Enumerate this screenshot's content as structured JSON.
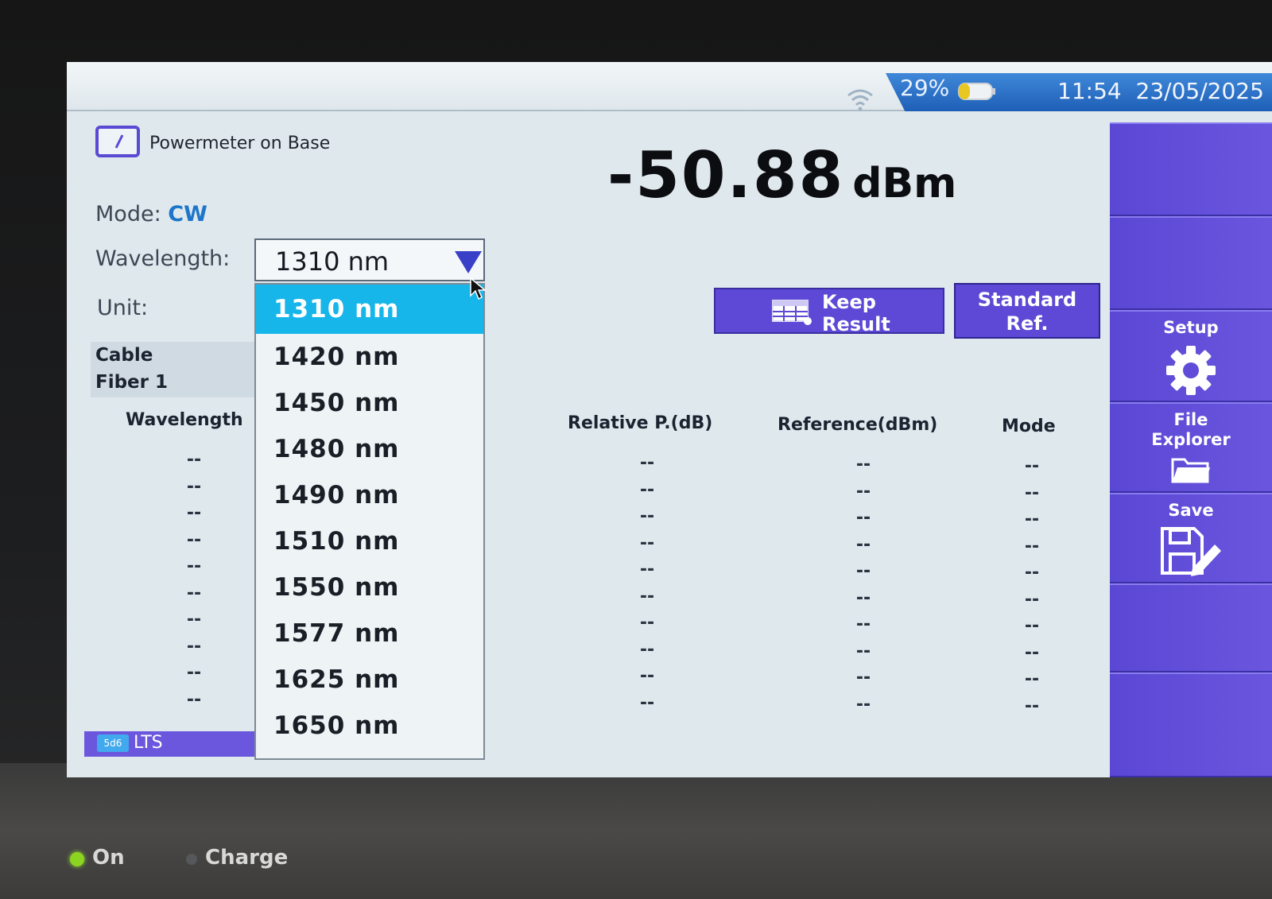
{
  "status_bar": {
    "battery_percent": "29%",
    "time": "11:54",
    "date": "23/05/2025"
  },
  "header": {
    "app_title": "Powermeter on Base",
    "reading_value": "-50.88",
    "reading_unit": "dBm"
  },
  "settings": {
    "mode_label": "Mode:",
    "mode_value": "CW",
    "wavelength_label": "Wavelength:",
    "wavelength_value": "1310 nm",
    "unit_label": "Unit:"
  },
  "wavelength_options": [
    "1310 nm",
    "1420 nm",
    "1450 nm",
    "1480 nm",
    "1490 nm",
    "1510 nm",
    "1550 nm",
    "1577 nm",
    "1625 nm",
    "1650 nm"
  ],
  "selected_option_index": 0,
  "cable": {
    "line1": "Cable",
    "line2": "Fiber  1"
  },
  "actions": {
    "keep_result_line1": "Keep",
    "keep_result_line2": "Result",
    "standard_ref_line1": "Standard",
    "standard_ref_line2": "Ref."
  },
  "table": {
    "headers": {
      "wavelength": "Wavelength",
      "relative": "Relative P.(dB)",
      "reference": "Reference(dBm)",
      "mode": "Mode"
    },
    "rows": [
      {
        "wavelength": "--",
        "relative": "--",
        "reference": "--",
        "mode": "--"
      },
      {
        "wavelength": "--",
        "relative": "--",
        "reference": "--",
        "mode": "--"
      },
      {
        "wavelength": "--",
        "relative": "--",
        "reference": "--",
        "mode": "--"
      },
      {
        "wavelength": "--",
        "relative": "--",
        "reference": "--",
        "mode": "--"
      },
      {
        "wavelength": "--",
        "relative": "--",
        "reference": "--",
        "mode": "--"
      },
      {
        "wavelength": "--",
        "relative": "--",
        "reference": "--",
        "mode": "--"
      },
      {
        "wavelength": "--",
        "relative": "--",
        "reference": "--",
        "mode": "--"
      },
      {
        "wavelength": "--",
        "relative": "--",
        "reference": "--",
        "mode": "--"
      },
      {
        "wavelength": "--",
        "relative": "--",
        "reference": "--",
        "mode": "--"
      },
      {
        "wavelength": "--",
        "relative": "--",
        "reference": "--",
        "mode": "--"
      }
    ]
  },
  "footer": {
    "lts_label": "LTS"
  },
  "sidebar": {
    "setup_label": "Setup",
    "file_explorer_line1": "File",
    "file_explorer_line2": "Explorer",
    "save_label": "Save"
  },
  "device_leds": {
    "on_label": "On",
    "charge_label": "Charge"
  },
  "colors": {
    "accent_purple": "#5d49d5",
    "highlight_cyan": "#16b6ea",
    "mode_blue": "#1d76c9",
    "status_blue": "#1e5fb7"
  },
  "icons": [
    "wifi-icon",
    "battery-icon",
    "powermeter-icon",
    "chevron-down-icon",
    "cursor-icon",
    "table-icon",
    "gear-icon",
    "folder-icon",
    "save-icon"
  ]
}
